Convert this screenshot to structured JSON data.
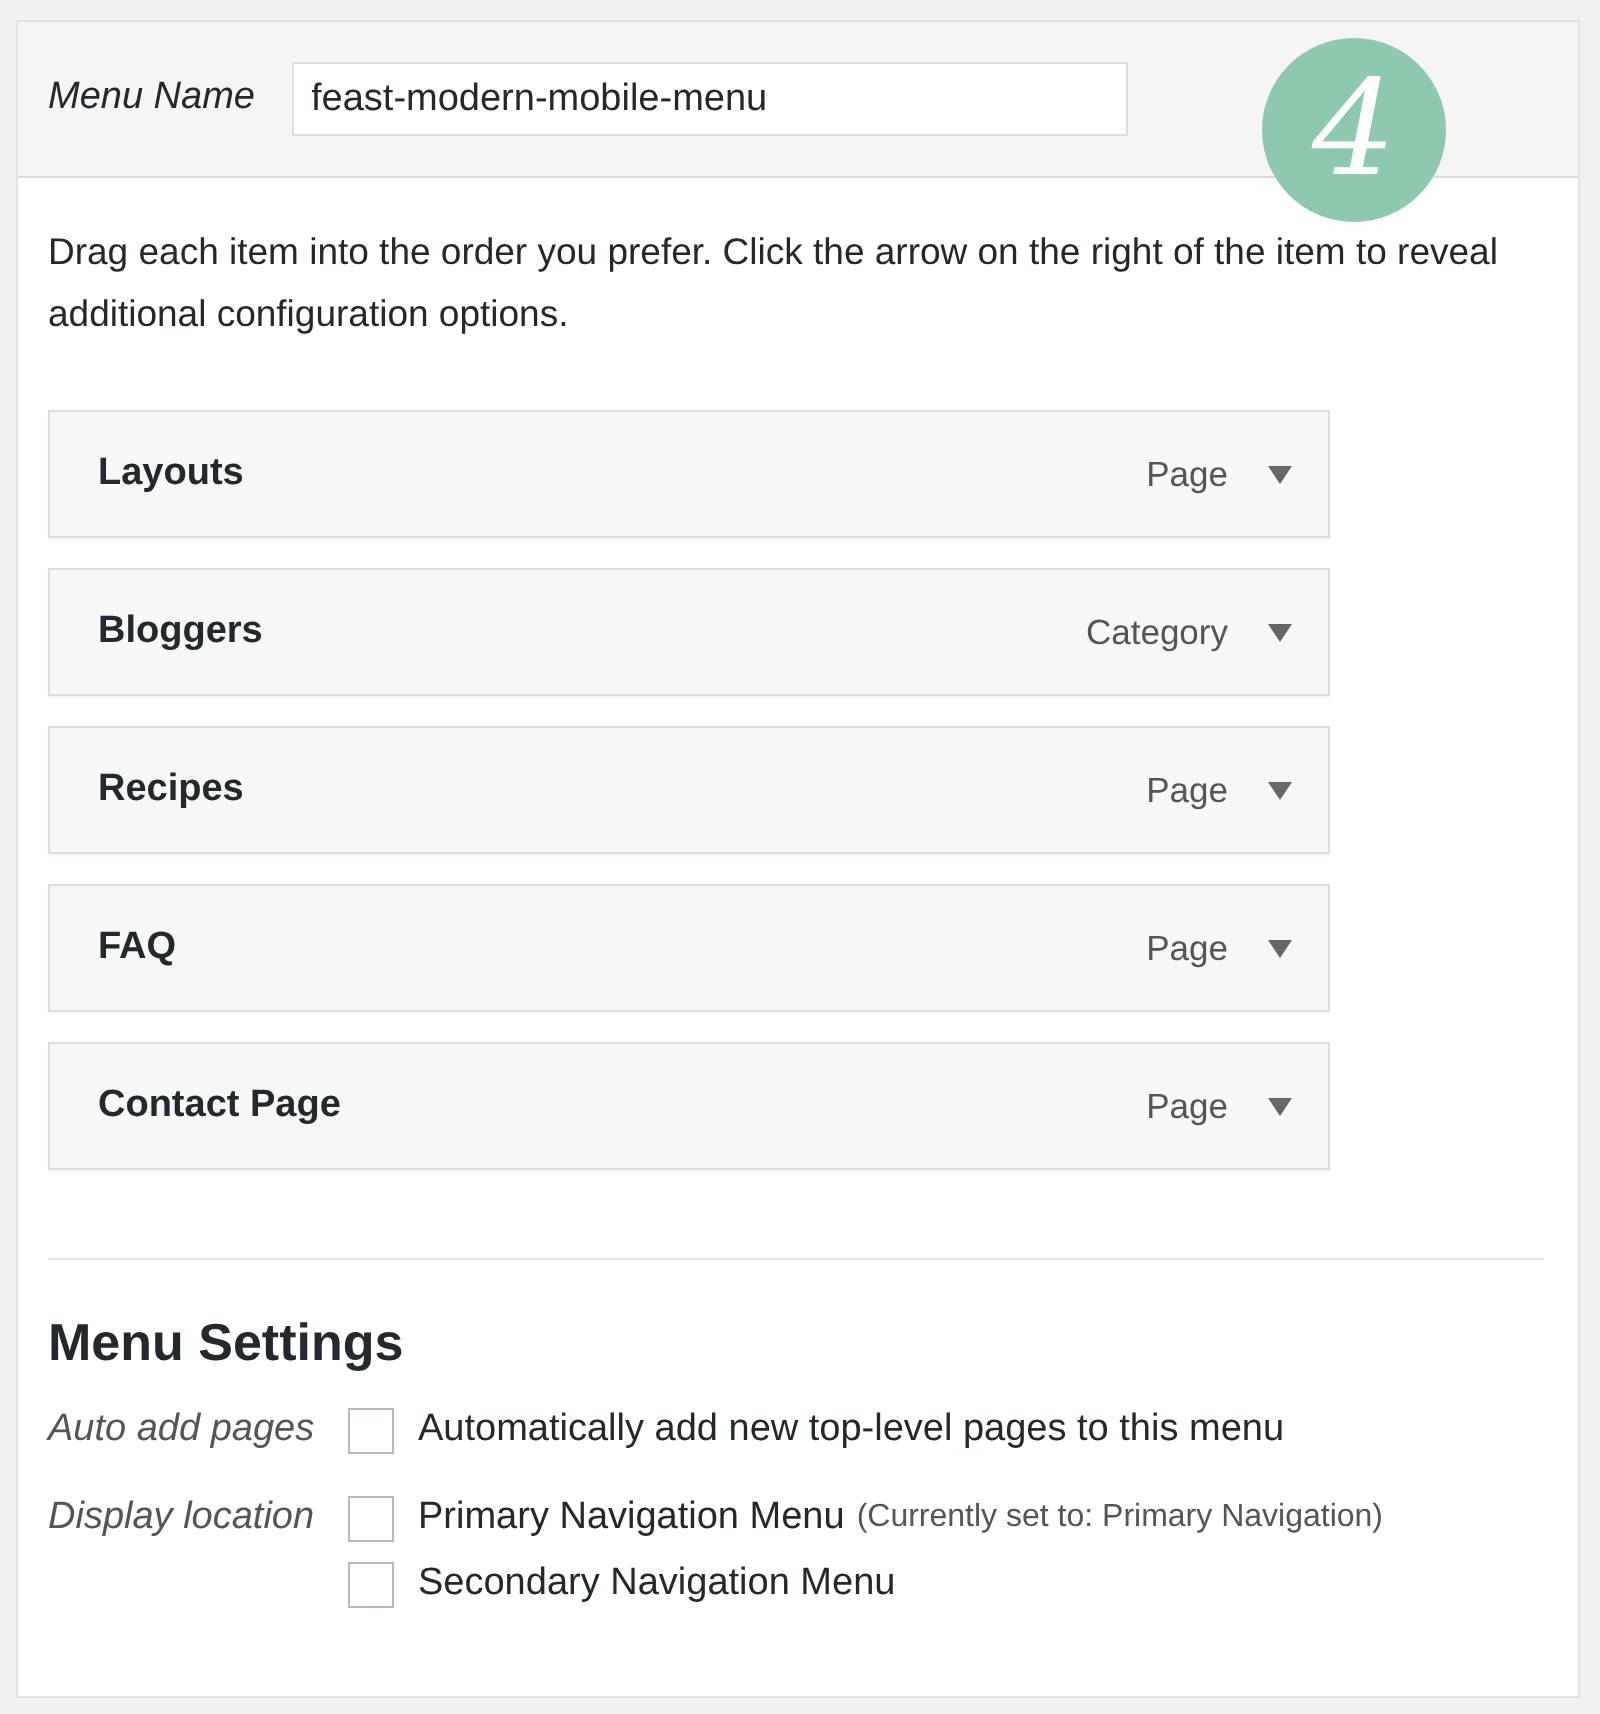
{
  "menu_name": {
    "label": "Menu Name",
    "value": "feast-modern-mobile-menu"
  },
  "step_badge": "4",
  "instructions": "Drag each item into the order you prefer. Click the arrow on the right of the item to reveal additional configuration options.",
  "menu_items": [
    {
      "title": "Layouts",
      "type": "Page"
    },
    {
      "title": "Bloggers",
      "type": "Category"
    },
    {
      "title": "Recipes",
      "type": "Page"
    },
    {
      "title": "FAQ",
      "type": "Page"
    },
    {
      "title": "Contact Page",
      "type": "Page"
    }
  ],
  "menu_settings": {
    "heading": "Menu Settings",
    "groups": [
      {
        "label": "Auto add pages",
        "options": [
          {
            "label": "Automatically add new top-level pages to this menu",
            "checked": false
          }
        ]
      },
      {
        "label": "Display location",
        "options": [
          {
            "label": "Primary Navigation Menu",
            "note": "(Currently set to: Primary Navigation)",
            "checked": false
          },
          {
            "label": "Secondary Navigation Menu",
            "checked": false
          }
        ]
      }
    ]
  }
}
